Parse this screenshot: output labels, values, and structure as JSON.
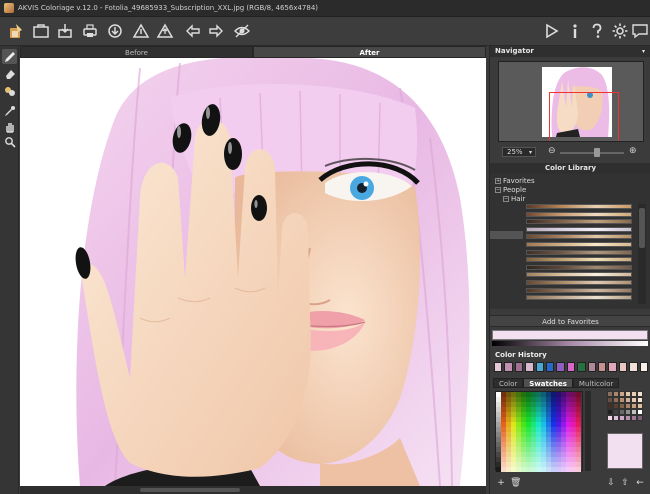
{
  "window": {
    "title": "AKVIS Coloriage v.12.0 - Fotolia_49685933_Subscription_XXL.jpg (RGB/8, 4656x4784)"
  },
  "tabs": {
    "before": "Before",
    "after": "After"
  },
  "navigator": {
    "title": "Navigator",
    "zoom": "25%"
  },
  "color_library": {
    "title": "Color Library",
    "tree": [
      {
        "sign": "+",
        "label": "Favorites"
      },
      {
        "sign": "−",
        "label": "People"
      },
      {
        "sign": "−",
        "label": "Hair"
      }
    ],
    "add_to_favorites": "Add to Favorites",
    "stripes": [
      [
        "#5a3a28",
        "#b8865a",
        "#e8d0b0",
        "#c89868"
      ],
      [
        "#704830",
        "#c89c74",
        "#f0dcc0",
        "#d0a878"
      ],
      [
        "#3a2a20",
        "#806048",
        "#c0a080",
        "#8a6a4c"
      ],
      [
        "#b8a8b8",
        "#d8d0e0",
        "#f4f0f8",
        "#c8c0d0"
      ],
      [
        "#6a4a30",
        "#a88060",
        "#e0c8a8",
        "#b89068"
      ],
      [
        "#a07850",
        "#d0b088",
        "#f8e8c8",
        "#d8b890"
      ],
      [
        "#403028",
        "#705848",
        "#b09880",
        "#806850"
      ],
      [
        "#806040",
        "#c0a070",
        "#f0e0b8",
        "#c8a878"
      ],
      [
        "#302820",
        "#604838",
        "#a08870",
        "#705848"
      ],
      [
        "#a08060",
        "#d8c0a0",
        "#f8f0e0",
        "#d0b898"
      ],
      [
        "#684830",
        "#a88868",
        "#e0c8b0",
        "#b09070"
      ],
      [
        "#503828",
        "#907058",
        "#d0b8a0",
        "#987860"
      ],
      [
        "#887058",
        "#c0a890",
        "#ece0d0",
        "#b8a088"
      ]
    ]
  },
  "color_history": {
    "title": "Color History",
    "colors": [
      "#e8c8d8",
      "#c090b0",
      "#a07090",
      "#d8b8d0",
      "#48a8d8",
      "#2868c8",
      "#9060c0",
      "#d868c8",
      "#287040",
      "#b08898",
      "#c89090",
      "#e0a8b8",
      "#e8c8c0",
      "#f0e0d8",
      "#f8f0e8"
    ]
  },
  "palette_tabs": {
    "color": "Color",
    "swatches": "Swatches",
    "multicolor": "Multicolor"
  },
  "palette": {
    "mini": [
      "#8a7060",
      "#a88870",
      "#c8a888",
      "#e0c8a8",
      "#e8d0b8",
      "#f0e0d0",
      "#6a5040",
      "#90705a",
      "#b89070",
      "#d0b098",
      "#e8c8b0",
      "#f4e4d4",
      "#403028",
      "#584030",
      "#806048",
      "#a88060",
      "#c8a080",
      "#e0c0a0",
      "#202020",
      "#404040",
      "#686868",
      "#909090",
      "#c0c0c0",
      "#ffffff",
      "#f0d8e8",
      "#e0c0d8",
      "#d0a8c8",
      "#b890b0",
      "#a07898",
      "#806078"
    ],
    "current": "#f2dff0"
  },
  "colors": {
    "accent": "#ee3333",
    "panel_bg": "#3b3b3b",
    "canvas_bg": "#ffffff"
  }
}
